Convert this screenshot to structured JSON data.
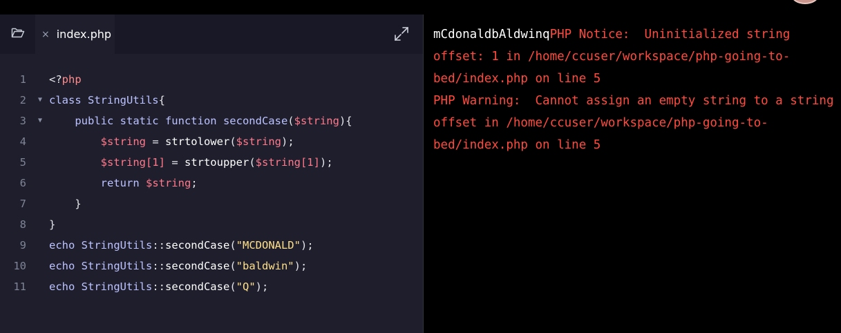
{
  "editor": {
    "tab": {
      "close_glyph": "×",
      "filename": "index.php"
    },
    "icons": {
      "folder": "folder-open-icon",
      "expand": "expand-icon",
      "fold": "chevron-down-icon"
    },
    "fold_glyph": "▼",
    "lines": [
      {
        "num": "1",
        "fold": false,
        "tokens": [
          {
            "t": "<?",
            "c": "pun"
          },
          {
            "t": "php",
            "c": "ph"
          }
        ]
      },
      {
        "num": "2",
        "fold": true,
        "tokens": [
          {
            "t": "class StringUtils",
            "c": "kw"
          },
          {
            "t": "{",
            "c": "pun"
          }
        ]
      },
      {
        "num": "3",
        "fold": true,
        "tokens": [
          {
            "t": "    public static function ",
            "c": "kw"
          },
          {
            "t": "secondCase",
            "c": "kw"
          },
          {
            "t": "(",
            "c": "pun"
          },
          {
            "t": "$string",
            "c": "var"
          },
          {
            "t": "){",
            "c": "pun"
          }
        ]
      },
      {
        "num": "4",
        "fold": false,
        "tokens": [
          {
            "t": "        ",
            "c": "pun"
          },
          {
            "t": "$string",
            "c": "var"
          },
          {
            "t": " = ",
            "c": "pun"
          },
          {
            "t": "strtolower",
            "c": "fn"
          },
          {
            "t": "(",
            "c": "pun"
          },
          {
            "t": "$string",
            "c": "var"
          },
          {
            "t": ");",
            "c": "pun"
          }
        ]
      },
      {
        "num": "5",
        "fold": false,
        "tokens": [
          {
            "t": "        ",
            "c": "pun"
          },
          {
            "t": "$string[1]",
            "c": "var"
          },
          {
            "t": " = ",
            "c": "pun"
          },
          {
            "t": "strtoupper",
            "c": "fn"
          },
          {
            "t": "(",
            "c": "pun"
          },
          {
            "t": "$string[1]",
            "c": "var"
          },
          {
            "t": ");",
            "c": "pun"
          }
        ]
      },
      {
        "num": "6",
        "fold": false,
        "tokens": [
          {
            "t": "        return ",
            "c": "kw"
          },
          {
            "t": "$string",
            "c": "var"
          },
          {
            "t": ";",
            "c": "pun"
          }
        ]
      },
      {
        "num": "7",
        "fold": false,
        "tokens": [
          {
            "t": "    }",
            "c": "pun"
          }
        ]
      },
      {
        "num": "8",
        "fold": false,
        "tokens": [
          {
            "t": "}",
            "c": "pun"
          }
        ]
      },
      {
        "num": "9",
        "fold": false,
        "tokens": [
          {
            "t": "echo StringUtils",
            "c": "kw"
          },
          {
            "t": "::",
            "c": "pun"
          },
          {
            "t": "secondCase",
            "c": "fn"
          },
          {
            "t": "(",
            "c": "pun"
          },
          {
            "t": "\"MCDONALD\"",
            "c": "str"
          },
          {
            "t": ");",
            "c": "pun"
          }
        ]
      },
      {
        "num": "10",
        "fold": false,
        "tokens": [
          {
            "t": "echo StringUtils",
            "c": "kw"
          },
          {
            "t": "::",
            "c": "pun"
          },
          {
            "t": "secondCase",
            "c": "fn"
          },
          {
            "t": "(",
            "c": "pun"
          },
          {
            "t": "\"baldwin\"",
            "c": "str"
          },
          {
            "t": ");",
            "c": "pun"
          }
        ]
      },
      {
        "num": "11",
        "fold": false,
        "tokens": [
          {
            "t": "echo StringUtils",
            "c": "kw"
          },
          {
            "t": "::",
            "c": "pun"
          },
          {
            "t": "secondCase",
            "c": "fn"
          },
          {
            "t": "(",
            "c": "pun"
          },
          {
            "t": "\"Q\"",
            "c": "str"
          },
          {
            "t": ");",
            "c": "pun"
          }
        ]
      }
    ]
  },
  "output": {
    "stdout": "mCdonaldbAldwinq",
    "stderr": "PHP Notice:  Uninitialized string offset: 1 in /home/ccuser/workspace/php-going-to-bed/index.php on line 5\nPHP Warning:  Cannot assign an empty string to a string offset in /home/ccuser/workspace/php-going-to-bed/index.php on line 5"
  },
  "colors": {
    "editor_bg": "#1e1e2d",
    "tabbar_bg": "#181826",
    "terminal_bg": "#000000",
    "error_red": "#ff4a3d",
    "keyword": "#bcc3ff",
    "variable": "#ff7a8a",
    "string": "#ffe08a"
  }
}
